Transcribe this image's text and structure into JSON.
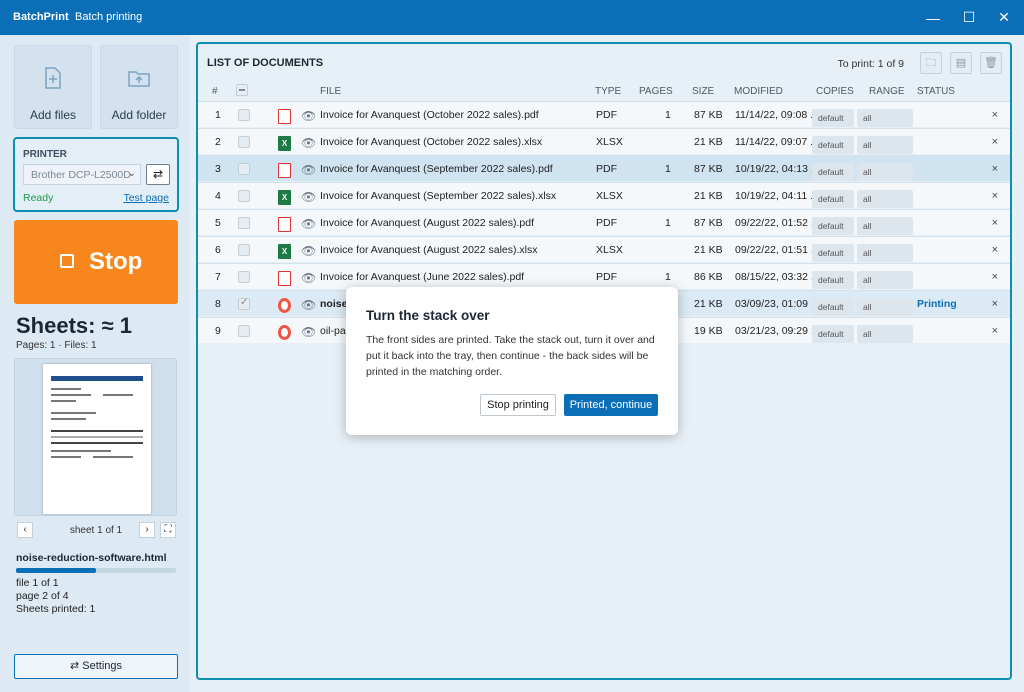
{
  "window": {
    "app_name": "BatchPrint",
    "subtitle": "Batch printing",
    "minimize": "—",
    "maximize": "☐",
    "close": "✕"
  },
  "left": {
    "add_files": "Add files",
    "add_folder": "Add folder",
    "printer": {
      "header": "PRINTER",
      "selected": "Brother DCP-L2500D",
      "status": "Ready",
      "test_page": "Test page"
    },
    "stop_label": "Stop",
    "sheets": "Sheets: ≈ 1",
    "pages_files": "Pages: 1 · Files: 1",
    "pager": {
      "prev": "‹",
      "text": "sheet 1 of 1",
      "next": "›",
      "full": "⛶"
    },
    "current_file": "noise-reduction-software.html",
    "progress": 0.5,
    "file_counter": "file 1 of 1",
    "page_counter": "page 2 of 4",
    "sheets_printed": "Sheets printed: 1",
    "settings": "⇄  Settings"
  },
  "main": {
    "title": "LIST OF DOCUMENTS",
    "to_print": "To print: 1 of 9",
    "columns": {
      "num": "#",
      "file": "FILE",
      "type": "TYPE",
      "pages": "PAGES",
      "size": "SIZE",
      "modified": "MODIFIED",
      "copies": "COPIES",
      "range": "RANGE",
      "status": "STATUS"
    },
    "rows": [
      {
        "num": "1",
        "file": "Invoice for Avanquest (October 2022 sales).pdf",
        "type": "PDF",
        "pages": "1",
        "size": "87 KB",
        "modified": "11/14/22, 09:08 ...",
        "copies": "default",
        "range": "all",
        "status": ""
      },
      {
        "num": "2",
        "file": "Invoice for Avanquest (October 2022 sales).xlsx",
        "type": "XLSX",
        "pages": "",
        "size": "21 KB",
        "modified": "11/14/22, 09:07 ...",
        "copies": "default",
        "range": "all",
        "status": ""
      },
      {
        "num": "3",
        "file": "Invoice for Avanquest (September 2022 sales).pdf",
        "type": "PDF",
        "pages": "1",
        "size": "87 KB",
        "modified": "10/19/22, 04:13 ...",
        "copies": "default",
        "range": "all",
        "status": ""
      },
      {
        "num": "4",
        "file": "Invoice for Avanquest (September 2022 sales).xlsx",
        "type": "XLSX",
        "pages": "",
        "size": "21 KB",
        "modified": "10/19/22, 04:11 ...",
        "copies": "default",
        "range": "all",
        "status": ""
      },
      {
        "num": "5",
        "file": "Invoice for Avanquest (August 2022 sales).pdf",
        "type": "PDF",
        "pages": "1",
        "size": "87 KB",
        "modified": "09/22/22, 01:52 ...",
        "copies": "default",
        "range": "all",
        "status": ""
      },
      {
        "num": "6",
        "file": "Invoice for Avanquest (August 2022 sales).xlsx",
        "type": "XLSX",
        "pages": "",
        "size": "21 KB",
        "modified": "09/22/22, 01:51 ...",
        "copies": "default",
        "range": "all",
        "status": ""
      },
      {
        "num": "7",
        "file": "Invoice for Avanquest (June 2022 sales).pdf",
        "type": "PDF",
        "pages": "1",
        "size": "86 KB",
        "modified": "08/15/22, 03:32 ...",
        "copies": "default",
        "range": "all",
        "status": ""
      },
      {
        "num": "8",
        "file": "noise",
        "type": "",
        "pages": "",
        "size": "21 KB",
        "modified": "03/09/23, 01:09 ...",
        "copies": "default",
        "range": "all",
        "status": "Printing"
      },
      {
        "num": "9",
        "file": "oil-pa",
        "type": "",
        "pages": "",
        "size": "19 KB",
        "modified": "03/21/23, 09:29 ...",
        "copies": "default",
        "range": "all",
        "status": ""
      }
    ],
    "remove": "×"
  },
  "dialog": {
    "title": "Turn the stack over",
    "body": "The front sides are printed. Take the stack out, turn it over and put it back into the tray, then continue - the back sides will be printed in the matching order.",
    "stop_button": "Stop printing",
    "continue_button": "Printed, continue"
  }
}
